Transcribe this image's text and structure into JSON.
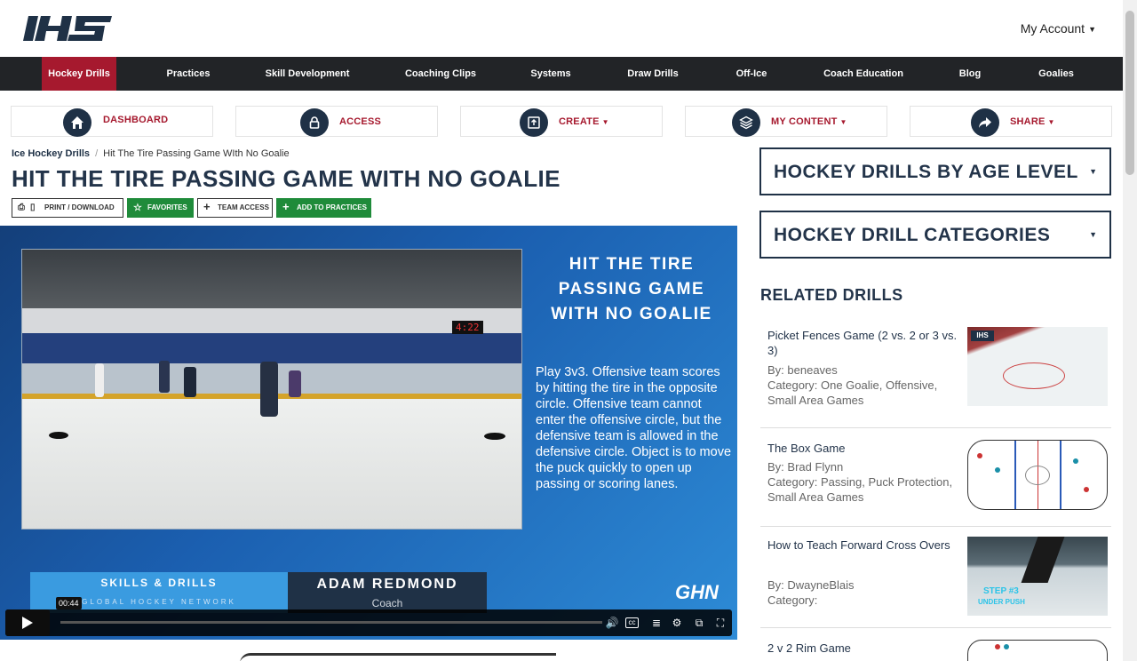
{
  "header": {
    "logo_text": "IHS",
    "account_label": "My Account"
  },
  "nav": {
    "items": [
      {
        "label": "Hockey Drills"
      },
      {
        "label": "Practices"
      },
      {
        "label": "Skill Development"
      },
      {
        "label": "Coaching Clips"
      },
      {
        "label": "Systems"
      },
      {
        "label": "Draw Drills"
      },
      {
        "label": "Off-Ice"
      },
      {
        "label": "Coach Education"
      },
      {
        "label": "Blog"
      },
      {
        "label": "Goalies"
      }
    ]
  },
  "actions": [
    {
      "label": "DASHBOARD",
      "icon": "home-icon"
    },
    {
      "label": "ACCESS",
      "icon": "lock-icon"
    },
    {
      "label": "CREATE",
      "icon": "create-icon"
    },
    {
      "label": "MY CONTENT",
      "icon": "layers-icon"
    },
    {
      "label": "SHARE",
      "icon": "share-icon"
    }
  ],
  "breadcrumb": {
    "first": "Ice Hockey Drills",
    "separator": "/",
    "current": "Hit The Tire Passing Game WIth No Goalie"
  },
  "page_title": "HIT THE TIRE PASSING GAME WITH NO GOALIE",
  "buttons": {
    "print": "PRINT / DOWNLOAD",
    "favorites": "FAVORITES",
    "team_access": "TEAM ACCESS",
    "add_practices": "ADD TO PRACTICES"
  },
  "video": {
    "title": "HIT THE TIRE PASSING GAME WITH NO GOALIE",
    "description": "Play 3v3. Offensive team scores by hitting the tire in the opposite circle. Offensive team cannot enter the offensive circle, but the defensive team is allowed in the defensive circle. Object is to move the puck quickly to open up passing or scoring lanes.",
    "lower_left_title": "SKILLS & DRILLS",
    "lower_left_sub": "GLOBAL HOCKEY NETWORK",
    "presenter_name": "ADAM REDMOND",
    "presenter_role": "Coach",
    "brand": "GHN",
    "scoreboard": "4:22",
    "time": "00:44",
    "progress": 0
  },
  "sidebar": {
    "age_level": "HOCKEY DRILLS BY AGE LEVEL",
    "categories": "HOCKEY DRILL CATEGORIES",
    "related_heading": "RELATED DRILLS",
    "related": [
      {
        "name": "Picket Fences Game (2 vs. 2 or 3 vs. 3)",
        "by": "By: beneaves",
        "category": "Category: One Goalie, Offensive, Small Area Games"
      },
      {
        "name": "The Box Game",
        "by": "By: Brad Flynn",
        "category": "Category: Passing, Puck Protection, Small Area Games"
      },
      {
        "name": "How to Teach Forward Cross Overs",
        "by": "By: DwayneBlais",
        "category": "Category:"
      },
      {
        "name": "2 v 2 Rim Game",
        "by": "",
        "category": ""
      }
    ],
    "thumb_text": {
      "step": "STEP #3",
      "step_sub": "UNDER PUSH"
    }
  },
  "colors": {
    "nav_bg": "#222427",
    "accent": "#a6192e",
    "navy": "#1f3146",
    "green": "#1f8b3a"
  }
}
